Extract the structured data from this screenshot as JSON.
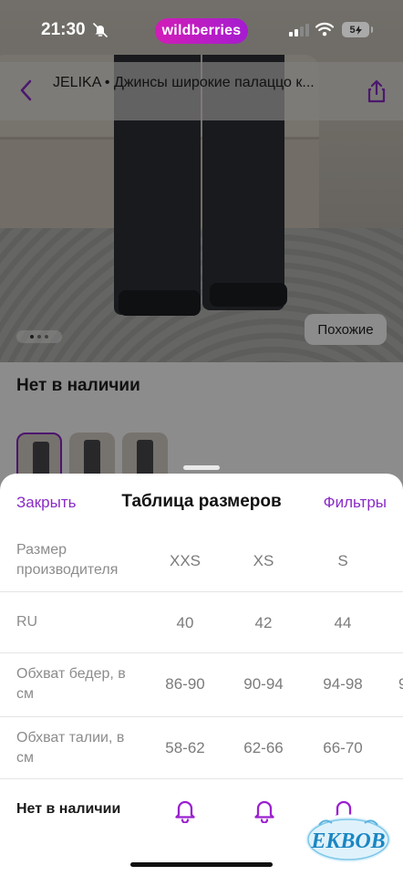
{
  "status_bar": {
    "time": "21:30",
    "app_badge": "wildberries",
    "battery": "5"
  },
  "product_page": {
    "title": "JELIKA • Джинсы широкие палаццо к...",
    "similar_button": "Похожие",
    "availability": "Нет в наличии"
  },
  "sheet": {
    "close_label": "Закрыть",
    "title": "Таблица размеров",
    "filters_label": "Фильтры",
    "rows": [
      {
        "label": "Размер производителя",
        "values": [
          "XXS",
          "XS",
          "S"
        ]
      },
      {
        "label": "RU",
        "values": [
          "40",
          "42",
          "44"
        ]
      },
      {
        "label": "Обхват бедер, в см",
        "values": [
          "86-90",
          "90-94",
          "94-98"
        ],
        "overflow": "9"
      },
      {
        "label": "Обхват талии, в см",
        "values": [
          "58-62",
          "62-66",
          "66-70"
        ]
      }
    ],
    "stock_label": "Нет в наличии",
    "notify_icon": "bell-icon"
  },
  "watermark": {
    "text": "EKBOB",
    "icon": "ekbob-logo"
  },
  "colors": {
    "accent": "#8a2bc6",
    "brand_gradient_start": "#d11db7",
    "brand_gradient_end": "#a51bd0",
    "thumb_selected": "#8b25c9"
  }
}
